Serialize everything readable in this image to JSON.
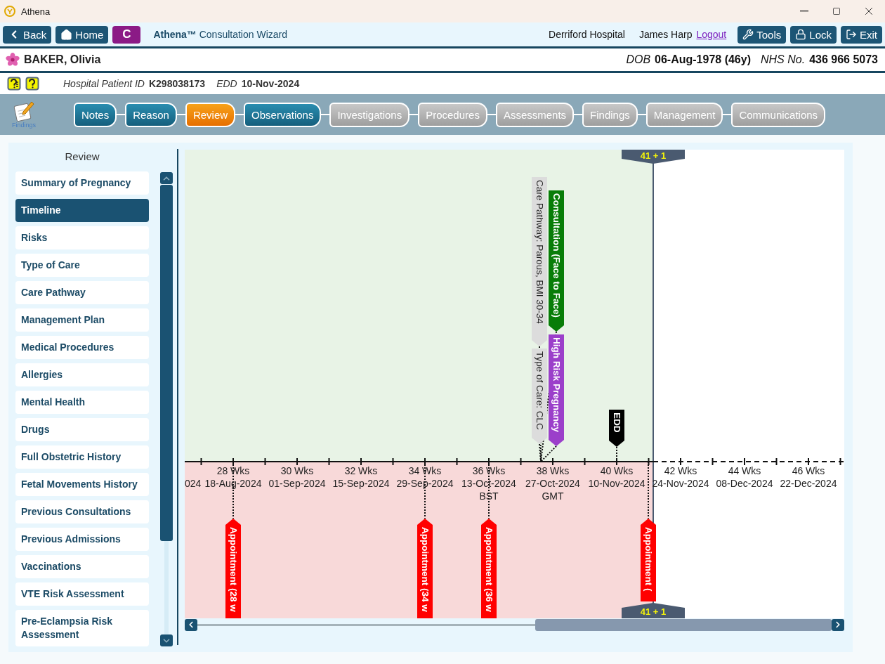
{
  "window": {
    "title": "Athena"
  },
  "toolbar": {
    "nav_buttons": [
      {
        "kind": "back",
        "label": "Back"
      },
      {
        "kind": "home",
        "label": "Home"
      },
      {
        "kind": "letter",
        "label": "C"
      }
    ],
    "app_title": "**Athena™** Consultation Wizard",
    "hospital": "Derriford Hospital",
    "user": "James Harp",
    "logout": "Logout",
    "actions": [
      {
        "kind": "tools",
        "label": "Tools"
      },
      {
        "kind": "lock",
        "label": "Lock"
      },
      {
        "kind": "exit",
        "label": "Exit"
      }
    ]
  },
  "patient": {
    "name": "BAKER, Olivia",
    "dob_label": "DOB",
    "dob": "06-Aug-1978 (46y)",
    "nhs_label": "NHS No.",
    "nhs": "436 966 5073"
  },
  "info": {
    "id_label": "Hospital Patient ID",
    "id": "K298038173",
    "edd_label": "EDD",
    "edd": "10-Nov-2024"
  },
  "stage_nav": {
    "icon_label": "Findings",
    "stages": [
      {
        "label": "Notes",
        "visited": true,
        "selected": false
      },
      {
        "label": "Reason",
        "visited": true,
        "selected": false
      },
      {
        "label": "Review",
        "visited": true,
        "selected": true
      },
      {
        "label": "Observations",
        "visited": true,
        "selected": false
      },
      {
        "label": "Investigations",
        "visited": false,
        "selected": false
      },
      {
        "label": "Procedures",
        "visited": false,
        "selected": false
      },
      {
        "label": "Assessments",
        "visited": false,
        "selected": false
      },
      {
        "label": "Findings",
        "visited": false,
        "selected": false
      },
      {
        "label": "Management",
        "visited": false,
        "selected": false
      },
      {
        "label": "Communications",
        "visited": false,
        "selected": false
      }
    ]
  },
  "review": {
    "title": "Review",
    "items": [
      {
        "label": "Summary of Pregnancy",
        "selected": false
      },
      {
        "label": "Timeline",
        "selected": true
      },
      {
        "label": "Risks",
        "selected": false
      },
      {
        "label": "Type of Care",
        "selected": false
      },
      {
        "label": "Care Pathway",
        "selected": false
      },
      {
        "label": "Management Plan",
        "selected": false
      },
      {
        "label": "Medical Procedures",
        "selected": false
      },
      {
        "label": "Allergies",
        "selected": false
      },
      {
        "label": "Mental Health",
        "selected": false
      },
      {
        "label": "Drugs",
        "selected": false
      },
      {
        "label": "Full Obstetric History",
        "selected": false
      },
      {
        "label": "Fetal Movements History",
        "selected": false
      },
      {
        "label": "Previous Consultations",
        "selected": false
      },
      {
        "label": "Previous Admissions",
        "selected": false
      },
      {
        "label": "Vaccinations",
        "selected": false
      },
      {
        "label": "VTE Risk Assessment",
        "selected": false
      },
      {
        "label": "Pre-Eclampsia Risk Assessment",
        "selected": false
      }
    ]
  },
  "timeline": {
    "current_badges": [
      "41 + 1",
      "41 + 1"
    ],
    "axis_labels": [
      {
        "date": "024"
      },
      {
        "weeks": "28 Wks",
        "date": "18-Aug-2024"
      },
      {
        "weeks": "30 Wks",
        "date": "01-Sep-2024"
      },
      {
        "weeks": "32 Wks",
        "date": "15-Sep-2024"
      },
      {
        "weeks": "34 Wks",
        "date": "29-Sep-2024"
      },
      {
        "weeks": "36 Wks",
        "date": "13-Oct-2024",
        "zone": "BST"
      },
      {
        "weeks": "38 Wks",
        "date": "27-Oct-2024",
        "zone": "GMT"
      },
      {
        "weeks": "40 Wks",
        "date": "10-Nov-2024"
      },
      {
        "weeks": "42 Wks",
        "date": "24-Nov-2024"
      },
      {
        "weeks": "44 Wks",
        "date": "08-Dec-2024"
      },
      {
        "weeks": "46 Wks",
        "date": "22-Dec-2024"
      }
    ],
    "events": [
      {
        "kind": "above",
        "label": "Care Pathway: Parous, BMI 30-34",
        "color": "#dcdcdc"
      },
      {
        "kind": "above",
        "label": "Type of Care: CLC",
        "color": "#dcdcdc"
      },
      {
        "kind": "above",
        "label": "Consultation (Face to Face)",
        "color": "#087d08"
      },
      {
        "kind": "above",
        "label": "High Risk Pregnancy",
        "color": "#9b3fca"
      },
      {
        "kind": "above",
        "label": "EDD",
        "color": "#000000"
      },
      {
        "kind": "below",
        "label": "Appointment (28 w",
        "color": "#ff0000"
      },
      {
        "kind": "below",
        "label": "Appointment (34 w",
        "color": "#ff0000"
      },
      {
        "kind": "below",
        "label": "Appointment (36 w",
        "color": "#ff0000"
      },
      {
        "kind": "below",
        "label": "Appointment (",
        "color": "#ff0000"
      }
    ]
  }
}
